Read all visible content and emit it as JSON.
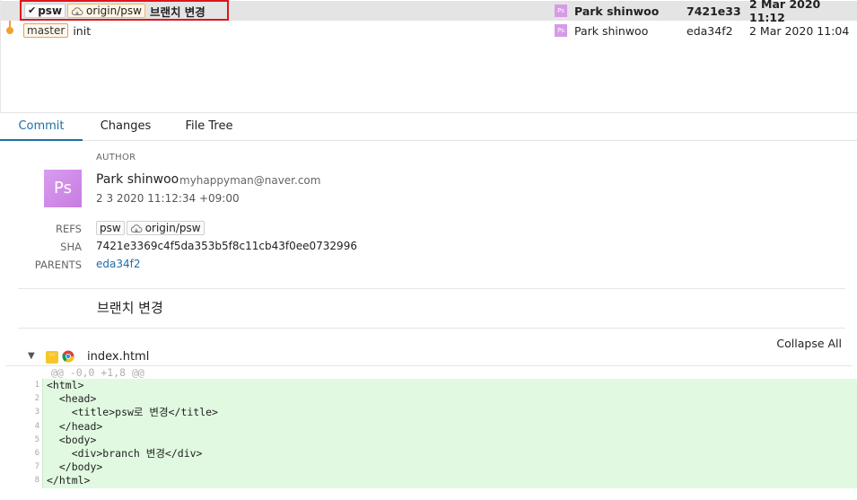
{
  "commits": [
    {
      "refs": [
        {
          "label": "psw",
          "kind": "current"
        },
        {
          "label": "origin/psw",
          "kind": "remote"
        }
      ],
      "message": "브랜치 변경",
      "author": "Park shinwoo",
      "avatar": "Ps",
      "sha": "7421e33",
      "date": "2 Mar 2020 11:12",
      "selected": true
    },
    {
      "refs": [
        {
          "label": "master",
          "kind": "branch"
        }
      ],
      "message": "init",
      "author": "Park shinwoo",
      "avatar": "Ps",
      "sha": "eda34f2",
      "date": "2 Mar 2020 11:04",
      "selected": false
    }
  ],
  "tabs": [
    {
      "label": "Commit",
      "active": true
    },
    {
      "label": "Changes",
      "active": false
    },
    {
      "label": "File Tree",
      "active": false
    }
  ],
  "details": {
    "author_label": "AUTHOR",
    "avatar": "Ps",
    "author_name": "Park shinwoo",
    "email": "myhappyman@naver.com",
    "date": "2 3 2020 11:12:34 +09:00",
    "refs_label": "REFS",
    "refs": [
      "psw",
      "origin/psw"
    ],
    "sha_label": "SHA",
    "sha": "7421e3369c4f5da353b5f8c11cb43f0ee0732996",
    "parents_label": "PARENTS",
    "parent": "eda34f2",
    "message": "브랜치 변경"
  },
  "collapse_all": "Collapse All",
  "file": {
    "name": "index.html",
    "toggle": "▼",
    "more": "···",
    "hunk": "@@ -0,0 +1,8 @@",
    "lines": [
      {
        "n": "1",
        "code": "<html>"
      },
      {
        "n": "2",
        "code": "  <head>"
      },
      {
        "n": "3",
        "code": "    <title>psw로 변경</title>"
      },
      {
        "n": "4",
        "code": "  </head>"
      },
      {
        "n": "5",
        "code": "  <body>"
      },
      {
        "n": "6",
        "code": "    <div>branch 변경</div>"
      },
      {
        "n": "7",
        "code": "  </body>"
      },
      {
        "n": "8",
        "code": "</html>"
      }
    ]
  },
  "colors": {
    "accent": "#1d6fa5",
    "graph": "#f0a030",
    "added_line": "#e0f9e0",
    "highlight": "#e0161b"
  }
}
